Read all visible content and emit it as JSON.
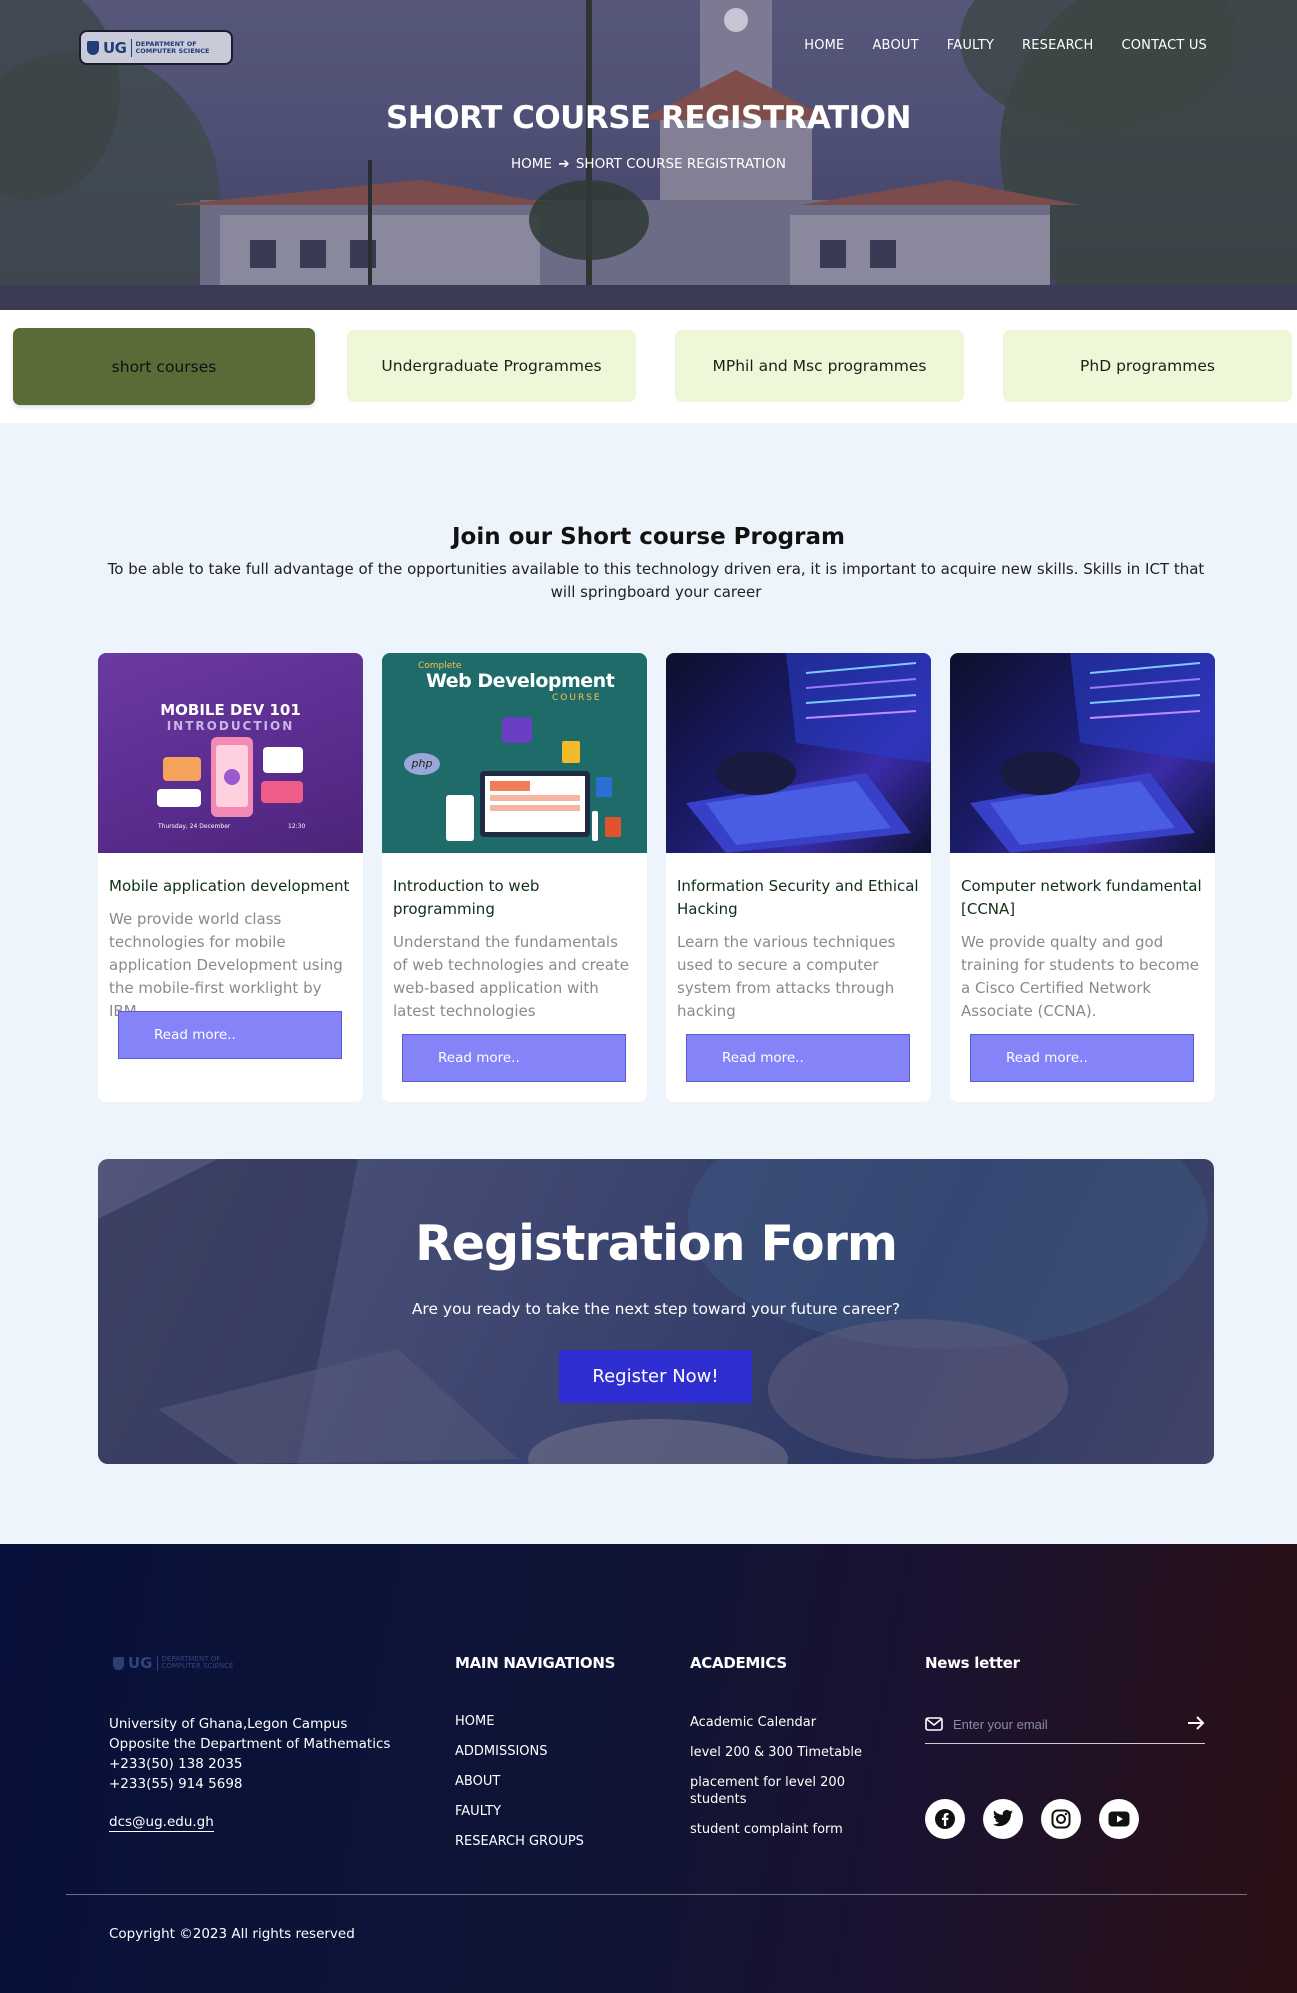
{
  "header": {
    "logo": {
      "text": "UG",
      "dept": "DEPARTMENT OF COMPUTER SCIENCE"
    },
    "nav": [
      "HOME",
      "ABOUT",
      "FAULTY",
      "RESEARCH",
      "CONTACT US"
    ],
    "title": "SHORT COURSE REGISTRATION",
    "breadcrumb": {
      "home": "HOME",
      "current": "SHORT COURSE REGISTRATION"
    }
  },
  "tabs": [
    {
      "label": "short courses",
      "active": true
    },
    {
      "label": "Undergraduate Programmes",
      "active": false
    },
    {
      "label": "MPhil and Msc programmes",
      "active": false
    },
    {
      "label": "PhD programmes",
      "active": false
    }
  ],
  "intro": {
    "title": "Join our Short course Program",
    "text": "To be able to take full advantage of the opportunities available to this technology driven era, it is important to acquire new skills. Skills in ICT that will springboard your career"
  },
  "courses": [
    {
      "title": "Mobile application development",
      "description": "We provide world class technologies for mobile application Development using the mobile-first worklight by IBM",
      "button": "Read more..",
      "image": {
        "headline": "MOBILE DEV 101",
        "sub": "INTRODUCTION",
        "date": "Thursday, 24 December",
        "time": "12:30"
      }
    },
    {
      "title": "Introduction to web programming",
      "description": "Understand the fundamentals of web technologies and create web-based application with latest technologies",
      "button": "Read more..",
      "image": {
        "kicker": "Complete",
        "headline": "Web Development",
        "sub": "COURSE",
        "tag": "php"
      }
    },
    {
      "title": "Information Security and Ethical Hacking",
      "description": "Learn the various techniques used to secure a computer system from attacks through hacking",
      "button": "Read more.."
    },
    {
      "title": "Computer network fundamental [CCNA]",
      "description": "We provide qualty and god training for students to become a Cisco Certified Network Associate (CCNA).",
      "button": "Read more.."
    }
  ],
  "registration": {
    "title": "Registration Form",
    "subtitle": "Are you ready to take the next step toward your future career?",
    "button": "Register Now!"
  },
  "footer": {
    "logo": {
      "text": "UG",
      "dept": "DEPARTMENT OF COMPUTER SCIENCE"
    },
    "address": [
      "University of Ghana,Legon Campus",
      "Opposite the Department of Mathematics",
      "+233(50) 138 2035",
      "+233(55) 914 5698"
    ],
    "email": "dcs@ug.edu.gh",
    "main_nav_title": "MAIN NAVIGATIONS",
    "main_nav": [
      "HOME",
      "ADDMISSIONS",
      "ABOUT",
      "FAULTY",
      "RESEARCH GROUPS"
    ],
    "academics_title": "ACADEMICS",
    "academics": [
      "Academic Calendar",
      "level 200 & 300 Timetable",
      "placement for level 200 students",
      "student complaint form"
    ],
    "newsletter_title": "News letter",
    "newsletter_placeholder": "Enter your email",
    "social": [
      "facebook-icon",
      "twitter-icon",
      "instagram-icon",
      "youtube-icon"
    ],
    "copyright": "Copyright ©2023 All rights reserved"
  },
  "colors": {
    "tab_active": "#5a6b37",
    "tab_inactive": "#eef7d8",
    "read_more": "#8483f7",
    "register": "#2f2fd1",
    "page_bg": "#eef4fc"
  }
}
